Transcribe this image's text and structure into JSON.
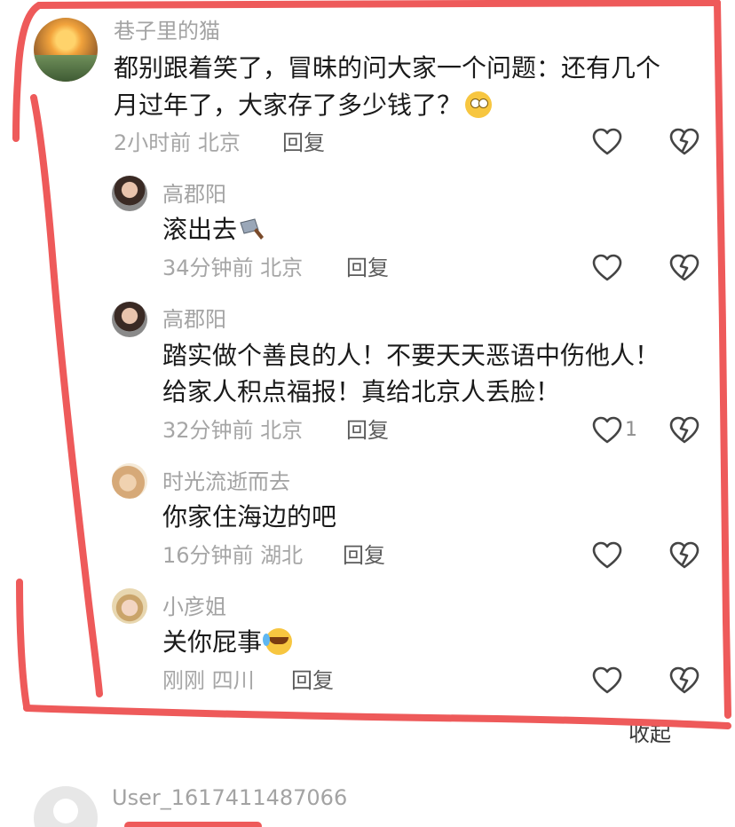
{
  "comments": {
    "main": {
      "username": "巷子里的猫",
      "line1": "都别跟着笑了，冒昧的问大家一个问题：还有几个",
      "line2": "月过年了，大家存了多少钱了？",
      "emoji": "rolling-eyes-emoji",
      "time_location": "2小时前 北京",
      "reply_label": "回复"
    },
    "replies": [
      {
        "username": "高郡阳",
        "text": "滚出去",
        "emoji": "cleaver-emoji",
        "time_location": "34分钟前 北京",
        "reply_label": "回复"
      },
      {
        "username": "高郡阳",
        "line1": "踏实做个善良的人！不要天天恶语中伤他人！",
        "line2": "给家人积点福报！真给北京人丢脸！",
        "time_location": "32分钟前 北京",
        "reply_label": "回复",
        "like_count": "1"
      },
      {
        "username": "时光流逝而去",
        "text": "你家住海边的吧",
        "time_location": "16分钟前 湖北",
        "reply_label": "回复"
      },
      {
        "username": "小彦姐",
        "text": "关你屁事",
        "emoji": "crying-laughing-emoji",
        "time_location": "刚刚 四川",
        "reply_label": "回复"
      }
    ],
    "collapse_label": "收起",
    "next": {
      "username": "User_1617411487066"
    }
  },
  "colors": {
    "annotation_red": "#ee5a5a",
    "meta_gray": "#a6a6a6",
    "text": "#1a1a1a"
  },
  "icons": [
    "heart-outline-icon",
    "broken-heart-icon"
  ]
}
